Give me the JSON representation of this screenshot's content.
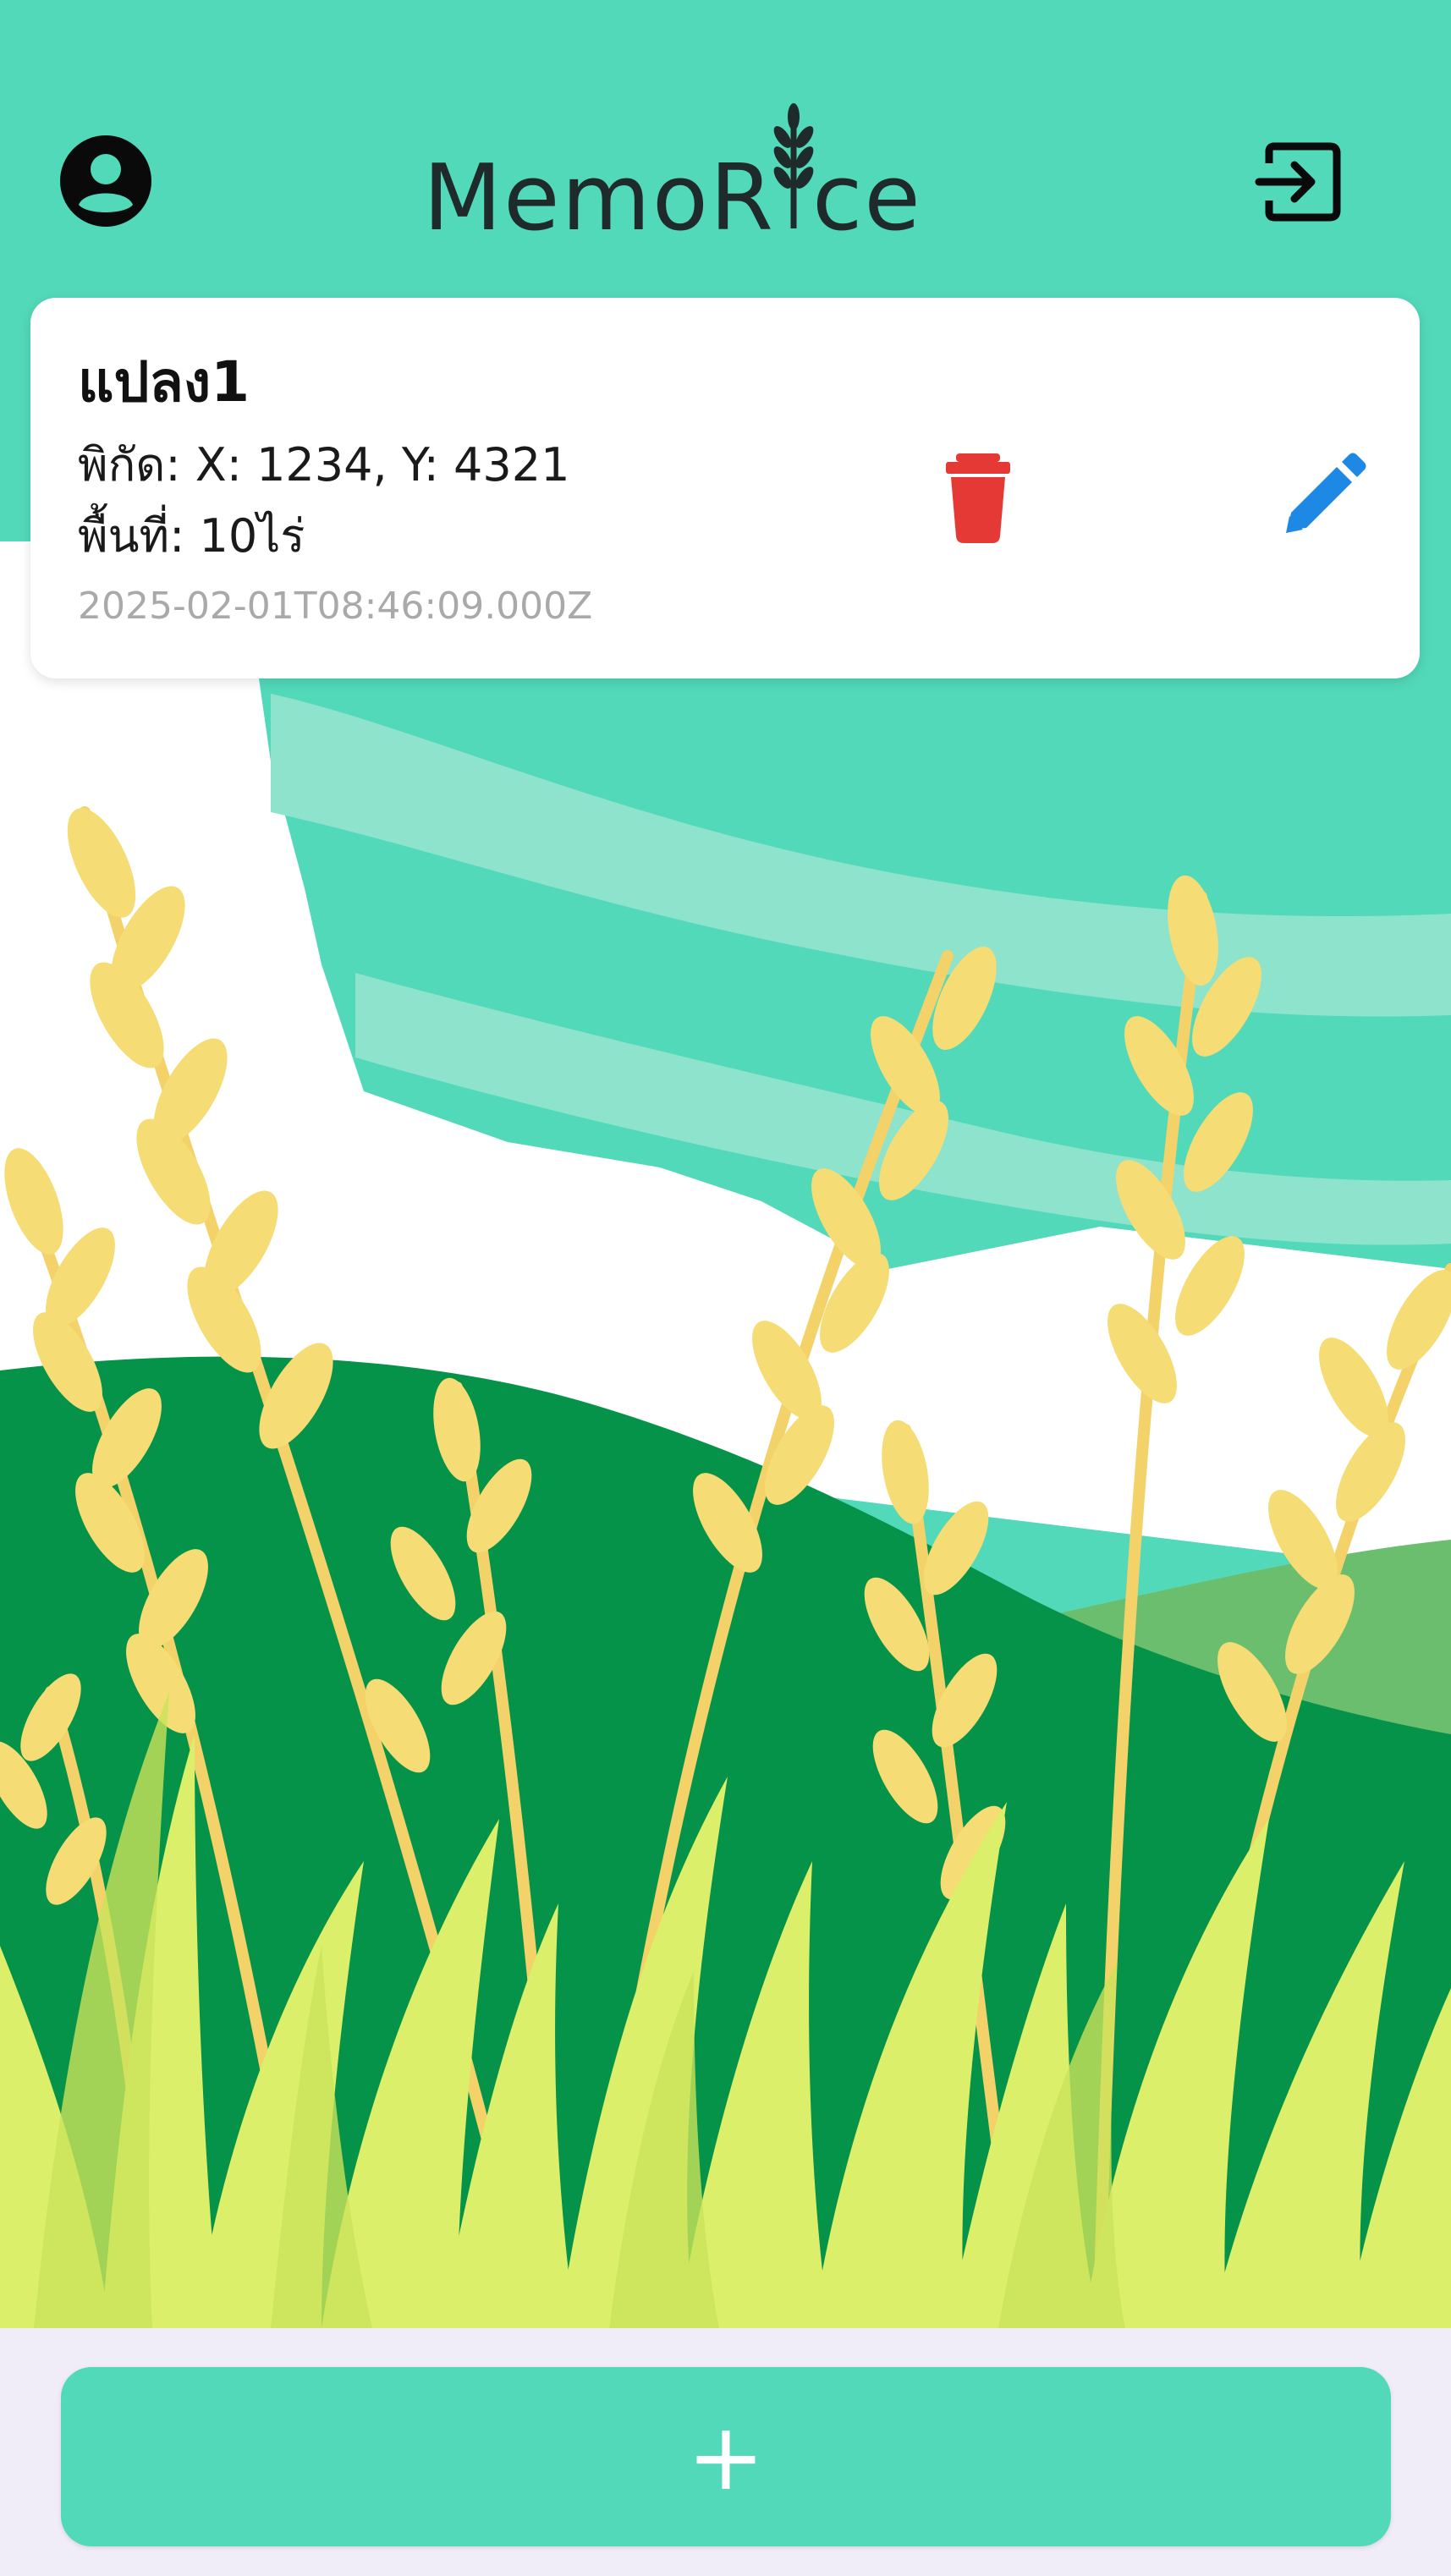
{
  "app": {
    "title": "MemoRice",
    "accent_color": "#52d9b9",
    "profile_icon": "account-circle-icon",
    "logout_icon": "logout-icon"
  },
  "plots": [
    {
      "name": "แปลง1",
      "coords": "พิกัด: X: 1234, Y: 4321",
      "area": "พื้นที่: 10ไร่",
      "timestamp": "2025-02-01T08:46:09.000Z",
      "delete_icon": "trash-icon",
      "delete_color": "#e53935",
      "edit_icon": "pencil-icon",
      "edit_color": "#1e88e5"
    }
  ],
  "fab": {
    "label": "+",
    "icon": "plus-icon"
  }
}
